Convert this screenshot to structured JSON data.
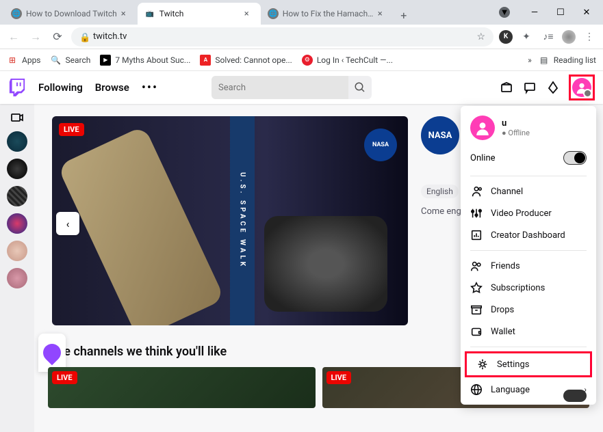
{
  "browser": {
    "tabs": [
      {
        "label": "How to Download Twitch"
      },
      {
        "label": "Twitch"
      },
      {
        "label": "How to Fix the Hamachi T"
      }
    ],
    "url": "twitch.tv",
    "bookmarks": {
      "apps": "Apps",
      "search": "Search",
      "myths": "7 Myths About Suc...",
      "solved": "Solved: Cannot ope...",
      "login": "Log In ‹ TechCult —...",
      "reading": "Reading list"
    },
    "profile_initial": "K"
  },
  "twitch": {
    "nav": {
      "following": "Following",
      "browse": "Browse"
    },
    "search_placeholder": "Search",
    "hero": {
      "live": "LIVE",
      "strip": "U.S.  SPACE  WALK",
      "channel_logo": "NASA",
      "lang": "English",
      "desc": "Come engine ESA as install power Station"
    },
    "section_title": "Live channels we think you'll like",
    "card_live": "LIVE"
  },
  "dropdown": {
    "username": "u",
    "status": "● Offline",
    "online": "Online",
    "items": {
      "channel": "Channel",
      "video": "Video Producer",
      "dashboard": "Creator Dashboard",
      "friends": "Friends",
      "subs": "Subscriptions",
      "drops": "Drops",
      "wallet": "Wallet",
      "settings": "Settings",
      "language": "Language"
    }
  }
}
